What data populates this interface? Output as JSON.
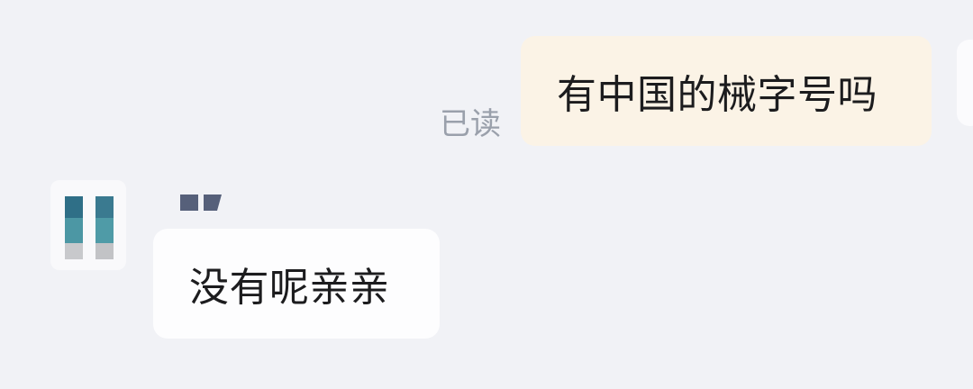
{
  "messages": [
    {
      "direction": "outgoing",
      "text": "有中国的械字号吗",
      "status": "已读",
      "bubble_color": "#fbf3e6"
    },
    {
      "direction": "incoming",
      "text": "没有呢亲亲",
      "sender_avatar": "pixelated-avatar",
      "sender_name": "pixelated-name",
      "bubble_color": "#fdfdfe"
    }
  ],
  "colors": {
    "background": "#f1f2f6",
    "read_receipt": "#9aa0ab",
    "text": "#1c1c1e"
  }
}
